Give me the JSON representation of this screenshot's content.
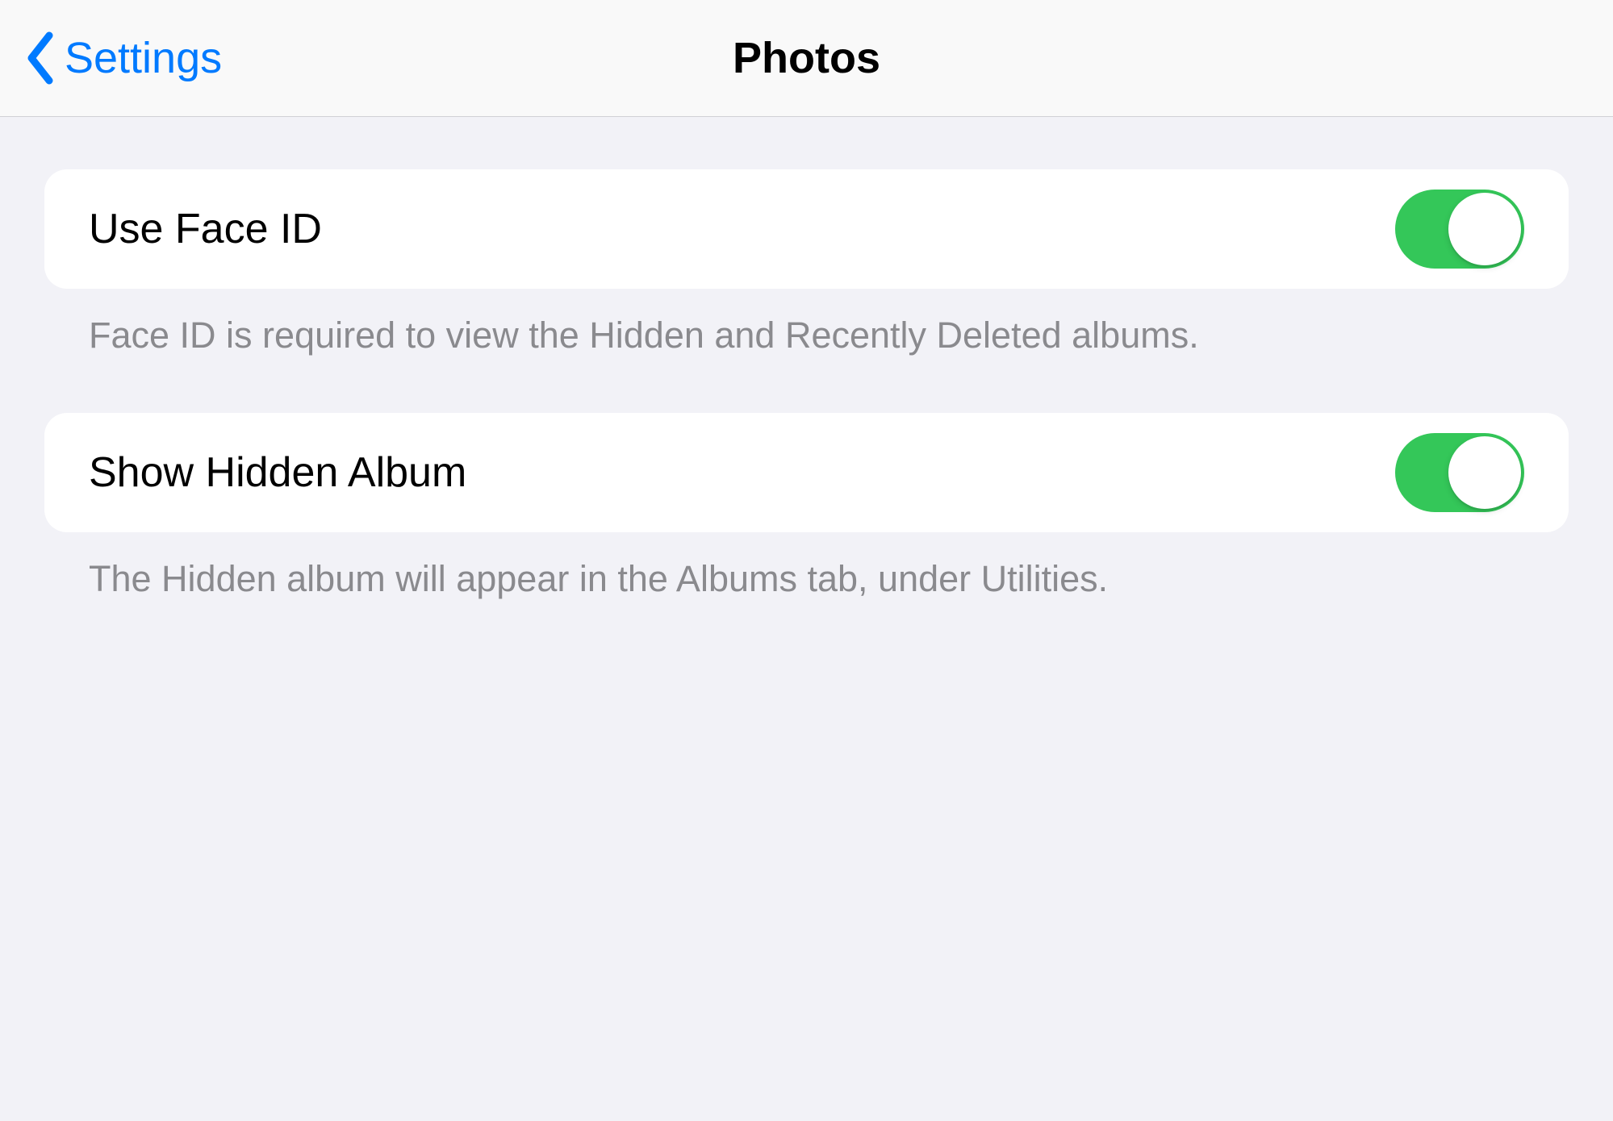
{
  "nav": {
    "back_label": "Settings",
    "title": "Photos"
  },
  "colors": {
    "accent": "#007aff",
    "toggle_on": "#34c759",
    "background": "#f2f2f7",
    "footer_text": "#8a8a8e"
  },
  "groups": [
    {
      "row": {
        "label": "Use Face ID",
        "toggle_on": true
      },
      "footer": "Face ID is required to view the Hidden and Recently Deleted albums."
    },
    {
      "row": {
        "label": "Show Hidden Album",
        "toggle_on": true
      },
      "footer": "The Hidden album will appear in the Albums tab, under Utilities."
    }
  ]
}
